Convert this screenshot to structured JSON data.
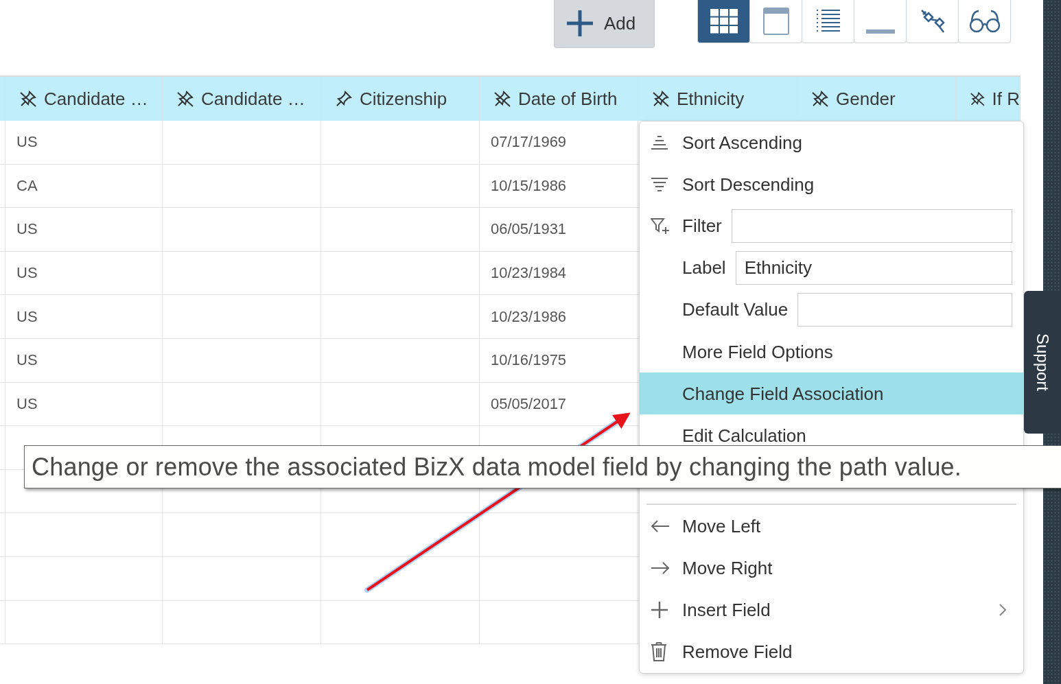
{
  "toolbar": {
    "add_button": {
      "label": "Add"
    },
    "view_buttons": [
      {
        "kind": "grid",
        "selected": true
      },
      {
        "kind": "window",
        "selected": false
      },
      {
        "kind": "list",
        "selected": false
      },
      {
        "kind": "line",
        "selected": false
      },
      {
        "kind": "plug",
        "selected": false
      },
      {
        "kind": "glasses",
        "selected": false
      }
    ]
  },
  "table": {
    "columns": [
      {
        "label": "Candidate …",
        "pinned": false
      },
      {
        "label": "Candidate …",
        "pinned": false
      },
      {
        "label": "Citizenship",
        "pinned": true
      },
      {
        "label": "Date of Birth",
        "pinned": false
      },
      {
        "label": "Ethnicity",
        "pinned": false
      },
      {
        "label": "Gender",
        "pinned": false
      },
      {
        "label": "If R",
        "pinned": false
      }
    ],
    "rows": [
      {
        "column_1": "US",
        "date_of_birth": "07/17/1969"
      },
      {
        "column_1": "CA",
        "date_of_birth": "10/15/1986"
      },
      {
        "column_1": "US",
        "date_of_birth": "06/05/1931"
      },
      {
        "column_1": "US",
        "date_of_birth": "10/23/1984"
      },
      {
        "column_1": "US",
        "date_of_birth": "10/23/1986"
      },
      {
        "column_1": "US",
        "date_of_birth": "10/16/1975"
      },
      {
        "column_1": "US",
        "date_of_birth": "05/05/2017"
      }
    ]
  },
  "column_menu": {
    "items": [
      {
        "kind": "sort_up",
        "label": "Sort Ascending",
        "selected": false,
        "submenu": false
      },
      {
        "kind": "sort_down",
        "label": "Sort Descending",
        "selected": false,
        "submenu": false
      },
      {
        "kind": "filter",
        "label": "Filter"
      },
      {
        "kind": "input",
        "label": "Label",
        "value": "Ethnicity"
      },
      {
        "kind": "input",
        "label": "Default Value"
      },
      {
        "kind": "text",
        "label": "More Field Options",
        "selected": false,
        "submenu": false
      },
      {
        "kind": "text",
        "label": "Change Field Association",
        "selected": true,
        "submenu": false
      },
      {
        "kind": "text",
        "label": "Edit Calculation",
        "selected": false,
        "submenu": false
      },
      {
        "kind": "divider"
      },
      {
        "kind": "move_left",
        "label": "Move Left",
        "selected": false,
        "submenu": false
      },
      {
        "kind": "move_right",
        "label": "Move Right",
        "selected": false,
        "submenu": false
      },
      {
        "kind": "insert",
        "label": "Insert Field",
        "selected": false,
        "submenu": true
      },
      {
        "kind": "remove",
        "label": "Remove Field",
        "selected": false,
        "submenu": false
      }
    ]
  },
  "tooltip": {
    "text": "Change or remove the associated BizX data model field by changing the path value."
  },
  "support_tab": {
    "label": "Support"
  }
}
